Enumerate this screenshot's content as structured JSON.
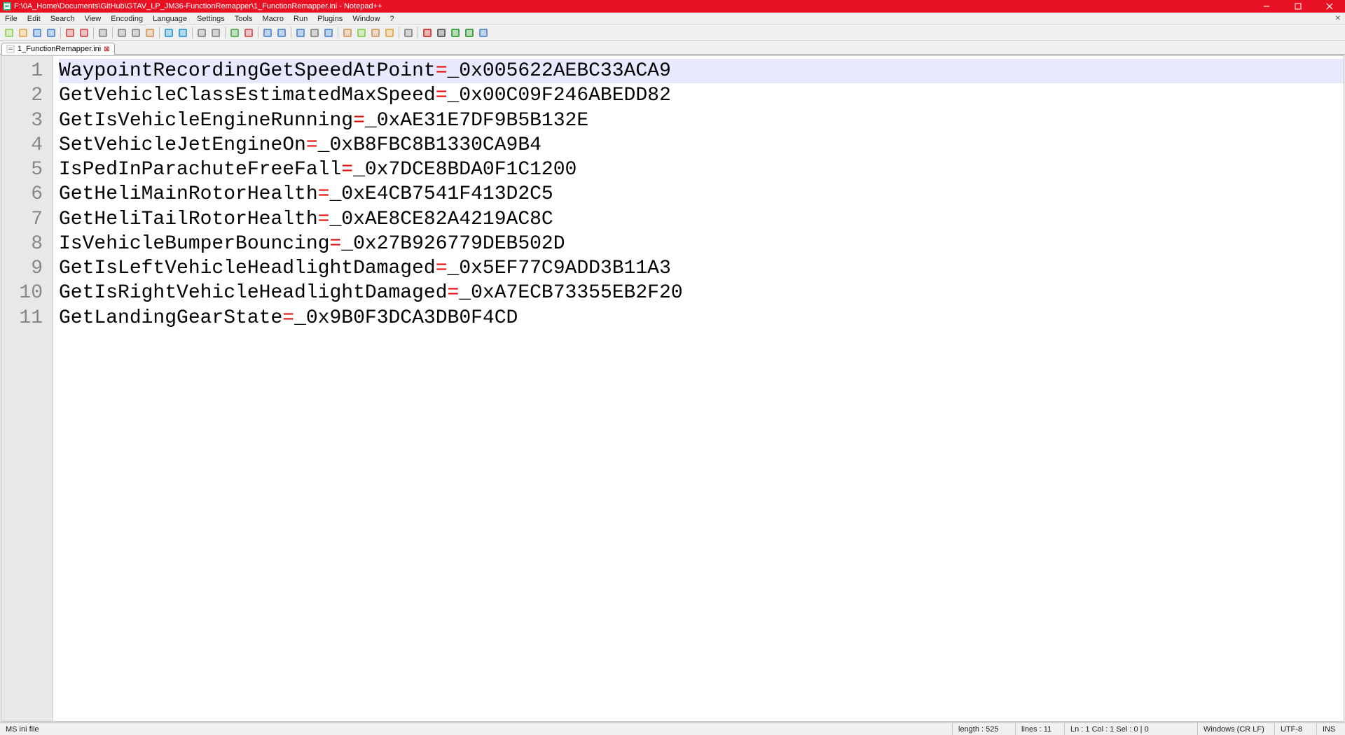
{
  "window": {
    "title": "F:\\0A_Home\\Documents\\GitHub\\GTAV_LP_JM36-FunctionRemapper\\1_FunctionRemapper.ini - Notepad++"
  },
  "menu": {
    "items": [
      "File",
      "Edit",
      "Search",
      "View",
      "Encoding",
      "Language",
      "Settings",
      "Tools",
      "Macro",
      "Run",
      "Plugins",
      "Window",
      "?"
    ]
  },
  "toolbar_icons": [
    "new-file-icon",
    "open-file-icon",
    "save-icon",
    "save-all-icon",
    "sep",
    "close-icon",
    "close-all-icon",
    "sep",
    "print-icon",
    "sep",
    "cut-icon",
    "copy-icon",
    "paste-icon",
    "sep",
    "undo-icon",
    "redo-icon",
    "sep",
    "find-icon",
    "replace-icon",
    "sep",
    "zoom-in-icon",
    "zoom-out-icon",
    "sep",
    "sync-v-icon",
    "sync-h-icon",
    "sep",
    "wrap-icon",
    "all-chars-icon",
    "indent-guide-icon",
    "sep",
    "lang-icon",
    "doc-map-icon",
    "func-list-icon",
    "folder-icon",
    "sep",
    "monitor-icon",
    "sep",
    "record-icon",
    "stop-icon",
    "play-icon",
    "play-multi-icon",
    "save-macro-icon"
  ],
  "tabs": [
    {
      "label": "1_FunctionRemapper.ini",
      "active": true
    }
  ],
  "editor": {
    "current_line": 1,
    "lines": [
      {
        "key": "WaypointRecordingGetSpeedAtPoint",
        "eq": "=",
        "val": "_0x005622AEBC33ACA9"
      },
      {
        "key": "GetVehicleClassEstimatedMaxSpeed",
        "eq": "=",
        "val": "_0x00C09F246ABEDD82"
      },
      {
        "key": "GetIsVehicleEngineRunning",
        "eq": "=",
        "val": "_0xAE31E7DF9B5B132E"
      },
      {
        "key": "SetVehicleJetEngineOn",
        "eq": "=",
        "val": "_0xB8FBC8B1330CA9B4"
      },
      {
        "key": "IsPedInParachuteFreeFall",
        "eq": "=",
        "val": "_0x7DCE8BDA0F1C1200"
      },
      {
        "key": "GetHeliMainRotorHealth",
        "eq": "=",
        "val": "_0xE4CB7541F413D2C5"
      },
      {
        "key": "GetHeliTailRotorHealth",
        "eq": "=",
        "val": "_0xAE8CE82A4219AC8C"
      },
      {
        "key": "IsVehicleBumperBouncing",
        "eq": "=",
        "val": "_0x27B926779DEB502D"
      },
      {
        "key": "GetIsLeftVehicleHeadlightDamaged",
        "eq": "=",
        "val": "_0x5EF77C9ADD3B11A3"
      },
      {
        "key": "GetIsRightVehicleHeadlightDamaged",
        "eq": "=",
        "val": "_0xA7ECB73355EB2F20"
      },
      {
        "key": "GetLandingGearState",
        "eq": "=",
        "val": "_0x9B0F3DCA3DB0F4CD"
      }
    ]
  },
  "statusbar": {
    "filetype": "MS ini file",
    "length": "length : 525",
    "lines": "lines : 11",
    "pos": "Ln : 1    Col : 1    Sel : 0 | 0",
    "eol": "Windows (CR LF)",
    "encoding": "UTF-8",
    "mode": "INS"
  }
}
